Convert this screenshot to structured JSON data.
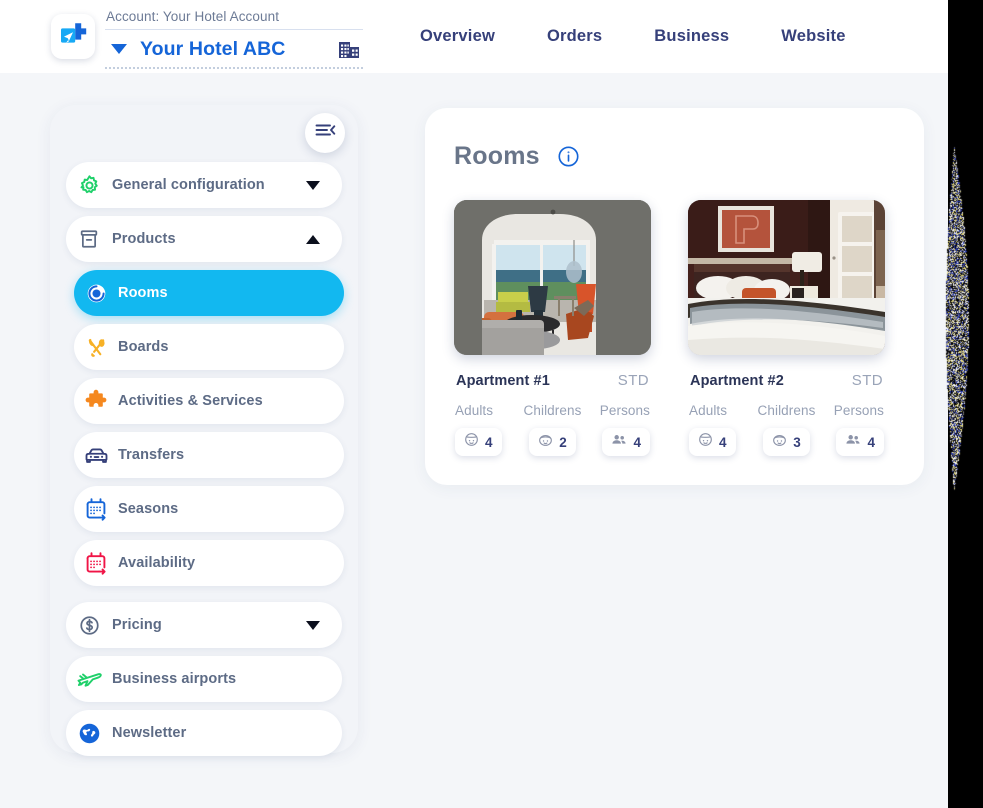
{
  "theme": {
    "page_bg": "#f4f6f9",
    "accent_cyan": "#12b8f0",
    "brand_blue": "#1565d8",
    "nav_navy": "#36407a",
    "muted_text": "#97a1b5"
  },
  "header": {
    "logo_icon": "plus-airplane-logo-icon",
    "account_label": "Account: Your Hotel Account",
    "account_name": "Your Hotel ABC",
    "account_caret_icon": "caret-down-icon",
    "building_icon": "building-icon",
    "nav": [
      {
        "label": "Overview",
        "name": "nav-overview"
      },
      {
        "label": "Orders",
        "name": "nav-orders"
      },
      {
        "label": "Business",
        "name": "nav-business"
      },
      {
        "label": "Website",
        "name": "nav-website"
      }
    ]
  },
  "sidebar": {
    "toggle_icon": "collapse-menu-icon",
    "items": [
      {
        "label": "General configuration",
        "icon": "gear-icon",
        "kind": "group",
        "expanded": false,
        "chevron": "chevron-down-icon"
      },
      {
        "label": "Products",
        "icon": "box-icon",
        "kind": "group",
        "expanded": true,
        "chevron": "chevron-up-icon"
      },
      {
        "label": "Rooms",
        "icon": "room-circle-icon",
        "kind": "sub",
        "active": true
      },
      {
        "label": "Boards",
        "icon": "cutlery-icon",
        "kind": "sub",
        "active": false
      },
      {
        "label": "Activities & Services",
        "icon": "puzzle-icon",
        "kind": "sub",
        "active": false
      },
      {
        "label": "Transfers",
        "icon": "car-icon",
        "kind": "sub",
        "active": false
      },
      {
        "label": "Seasons",
        "icon": "calendar-blue-icon",
        "kind": "sub",
        "active": false
      },
      {
        "label": "Availability",
        "icon": "calendar-red-icon",
        "kind": "sub",
        "active": false
      },
      {
        "label": "Pricing",
        "icon": "dollar-coin-icon",
        "kind": "group",
        "expanded": false,
        "chevron": "chevron-down-icon"
      },
      {
        "label": "Business airports",
        "icon": "airplane-icon",
        "kind": "group-plain"
      },
      {
        "label": "Newsletter",
        "icon": "globe-icon",
        "kind": "group-plain"
      }
    ]
  },
  "main": {
    "panel_title": "Rooms",
    "info_icon": "info-circle-icon",
    "occupancy_labels": [
      "Adults",
      "Childrens",
      "Persons"
    ],
    "rooms": [
      {
        "name": "Apartment #1",
        "code": "STD",
        "photo": "living-room-ocean-view-photo",
        "occupancy": [
          {
            "label": "Adults",
            "value": "4",
            "icon": "adult-face-icon"
          },
          {
            "label": "Childrens",
            "value": "2",
            "icon": "child-face-icon"
          },
          {
            "label": "Persons",
            "value": "4",
            "icon": "people-group-icon"
          }
        ]
      },
      {
        "name": "Apartment #2",
        "code": "STD",
        "photo": "hotel-bedroom-photo",
        "occupancy": [
          {
            "label": "Adults",
            "value": "4",
            "icon": "adult-face-icon"
          },
          {
            "label": "Childrens",
            "value": "3",
            "icon": "child-face-icon"
          },
          {
            "label": "Persons",
            "value": "4",
            "icon": "people-group-icon"
          }
        ]
      }
    ]
  }
}
